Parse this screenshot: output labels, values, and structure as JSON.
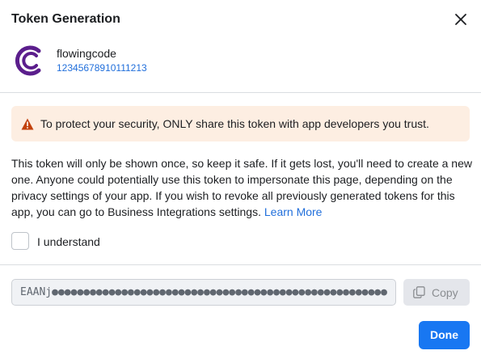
{
  "dialog": {
    "title": "Token Generation",
    "close_icon": "close-icon"
  },
  "page": {
    "name": "flowingcode",
    "id": "12345678910111213",
    "logo_icon": "flowingcode-logo",
    "logo_color": "#5b1e8c"
  },
  "warning": {
    "icon": "warning-icon",
    "text": "To protect your security, ONLY share this token with app developers you trust.",
    "background": "#fdeee2",
    "icon_color": "#c2410c"
  },
  "info": {
    "text": "This token will only be shown once, so keep it safe. If it gets lost, you'll need to create a new one. Anyone could potentially use this token to impersonate this page, depending on the privacy settings of your app. If you wish to revoke all previously generated tokens for this app, you can go to Business Integrations settings.",
    "link_text": "Learn More"
  },
  "acknowledge": {
    "label": "I understand",
    "checked": false
  },
  "token": {
    "value": "EAANj●●●●●●●●●●●●●●●●●●●●●●●●●●●●●●●●●●●●●●●●●●●●●●●●●●●●●"
  },
  "copy_button": {
    "label": "Copy",
    "icon": "copy-icon",
    "enabled": false
  },
  "done_button": {
    "label": "Done",
    "color": "#1877f2"
  }
}
